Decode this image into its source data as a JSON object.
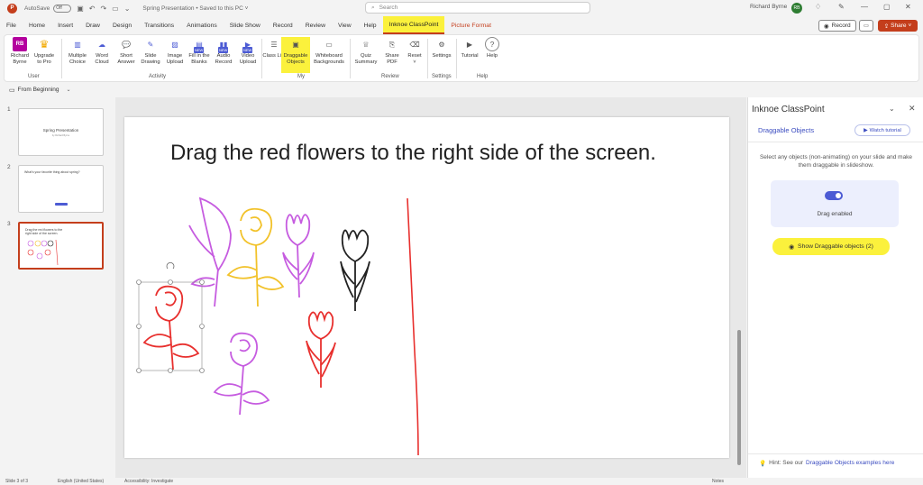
{
  "titlebar": {
    "app_icon": "powerpoint-icon",
    "autosave_label": "AutoSave",
    "autosave_state": "Off",
    "doc_title": "Spring Presentation  •  Saved to this PC  ˅",
    "search_placeholder": "Search",
    "user_name": "Richard Byrne",
    "user_initials": "RB"
  },
  "menu": {
    "tabs": [
      "File",
      "Home",
      "Insert",
      "Draw",
      "Design",
      "Transitions",
      "Animations",
      "Slide Show",
      "Record",
      "Review",
      "View",
      "Help",
      "Inknoe ClassPoint",
      "Picture Format"
    ],
    "record_label": "Record",
    "share_label": "Share"
  },
  "ribbon": {
    "user": {
      "profile": "Richard Byrne",
      "upgrade": "Upgrade to Pro",
      "initials": "RB",
      "group": "User"
    },
    "activity": {
      "multiple_choice": "Multiple Choice",
      "word_cloud": "Word Cloud",
      "short_answer": "Short Answer",
      "slide_drawing": "Slide Drawing",
      "image_upload": "Image Upload",
      "fill_blanks": "Fill in the Blanks",
      "audio_record": "Audio Record",
      "video_upload": "Video Upload",
      "group": "Activity",
      "new_badge": "NEW"
    },
    "my": {
      "class_list": "Class List",
      "draggable": "Draggable Objects",
      "whiteboard": "Whiteboard Backgrounds",
      "group": "My"
    },
    "review": {
      "quiz_summary": "Quiz Summary",
      "share_pdf": "Share PDF",
      "reset": "Reset",
      "group": "Review"
    },
    "settings": {
      "settings": "Settings",
      "group": "Settings"
    },
    "help": {
      "tutorial": "Tutorial",
      "help": "Help",
      "group": "Help"
    }
  },
  "quickbar": {
    "from_beginning": "From Beginning"
  },
  "thumbnails": {
    "slides": [
      {
        "num": "1",
        "title": "Spring Presentation",
        "subtitle": "by Richard Byrne"
      },
      {
        "num": "2",
        "title": "What's your favorite thing about spring?"
      },
      {
        "num": "3",
        "title": "Drag the red flowers to the right side of the screen."
      }
    ]
  },
  "slide": {
    "title": "Drag the red flowers to the right side of the screen."
  },
  "pane": {
    "title": "Inknoe ClassPoint",
    "subtitle": "Draggable Objects",
    "watch_tutorial": "Watch tutorial",
    "description": "Select any objects (non-animating) on your slide and make them draggable in slideshow.",
    "drag_status": "Drag enabled",
    "show_button": "Show Draggable objects (2)",
    "hint_prefix": "Hint: See our",
    "hint_link": "Draggable Objects examples here"
  },
  "statusbar": {
    "slide_count": "Slide 3 of 3",
    "language": "English (United States)",
    "accessibility": "Accessibility: Investigate",
    "notes": "Notes"
  },
  "colors": {
    "accent": "#c43e1c",
    "highlight": "#fbf13c",
    "classpoint_blue": "#4c5bd4",
    "flower_red": "#e8302e",
    "flower_purple": "#c65ce0",
    "flower_yellow": "#f2c22a"
  }
}
